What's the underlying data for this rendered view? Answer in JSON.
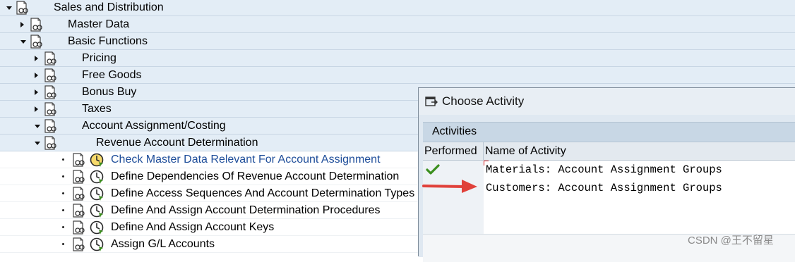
{
  "tree": {
    "rows": [
      {
        "label": "Sales and Distribution",
        "kind": "folder",
        "state": "open",
        "level": 0,
        "has_clock": false
      },
      {
        "label": "Master Data",
        "kind": "folder",
        "state": "closed",
        "level": 1,
        "has_clock": false
      },
      {
        "label": "Basic Functions",
        "kind": "folder",
        "state": "open",
        "level": 1,
        "has_clock": false
      },
      {
        "label": "Pricing",
        "kind": "folder",
        "state": "closed",
        "level": 2,
        "has_clock": false
      },
      {
        "label": "Free Goods",
        "kind": "folder",
        "state": "closed",
        "level": 2,
        "has_clock": false
      },
      {
        "label": "Bonus Buy",
        "kind": "folder",
        "state": "closed",
        "level": 2,
        "has_clock": false
      },
      {
        "label": "Taxes",
        "kind": "folder",
        "state": "closed",
        "level": 2,
        "has_clock": false
      },
      {
        "label": "Account Assignment/Costing",
        "kind": "folder",
        "state": "open",
        "level": 2,
        "has_clock": false
      },
      {
        "label": "Revenue Account Determination",
        "kind": "folder",
        "state": "open",
        "level": 3,
        "has_clock": false
      },
      {
        "label": "Check Master Data Relevant For Account Assignment",
        "kind": "leaf",
        "state": "none",
        "level": 4,
        "has_clock": true,
        "selected": true
      },
      {
        "label": "Define Dependencies Of Revenue Account Determination",
        "kind": "leaf",
        "state": "none",
        "level": 4,
        "has_clock": true
      },
      {
        "label": "Define Access Sequences And Account Determination Types",
        "kind": "leaf",
        "state": "none",
        "level": 4,
        "has_clock": true
      },
      {
        "label": "Define And Assign Account Determination Procedures",
        "kind": "leaf",
        "state": "none",
        "level": 4,
        "has_clock": true
      },
      {
        "label": "Define And Assign Account Keys",
        "kind": "leaf",
        "state": "none",
        "level": 4,
        "has_clock": true
      },
      {
        "label": "Assign G/L Accounts",
        "kind": "leaf",
        "state": "none",
        "level": 4,
        "has_clock": true
      }
    ]
  },
  "dialog": {
    "title": "Choose Activity",
    "section_label": "Activities",
    "columns": {
      "performed": "Performed",
      "name": "Name of Activity"
    },
    "rows": [
      {
        "performed": true,
        "name": "Materials: Account Assignment Groups"
      },
      {
        "performed": false,
        "name": "Customers: Account Assignment Groups"
      },
      {
        "performed": false,
        "name": ""
      },
      {
        "performed": false,
        "name": ""
      }
    ]
  },
  "colors": {
    "accent": "#1f4e9a",
    "check": "#3b8f1e",
    "arrow": "#e0413a"
  },
  "watermark": "CSDN @王不留星"
}
